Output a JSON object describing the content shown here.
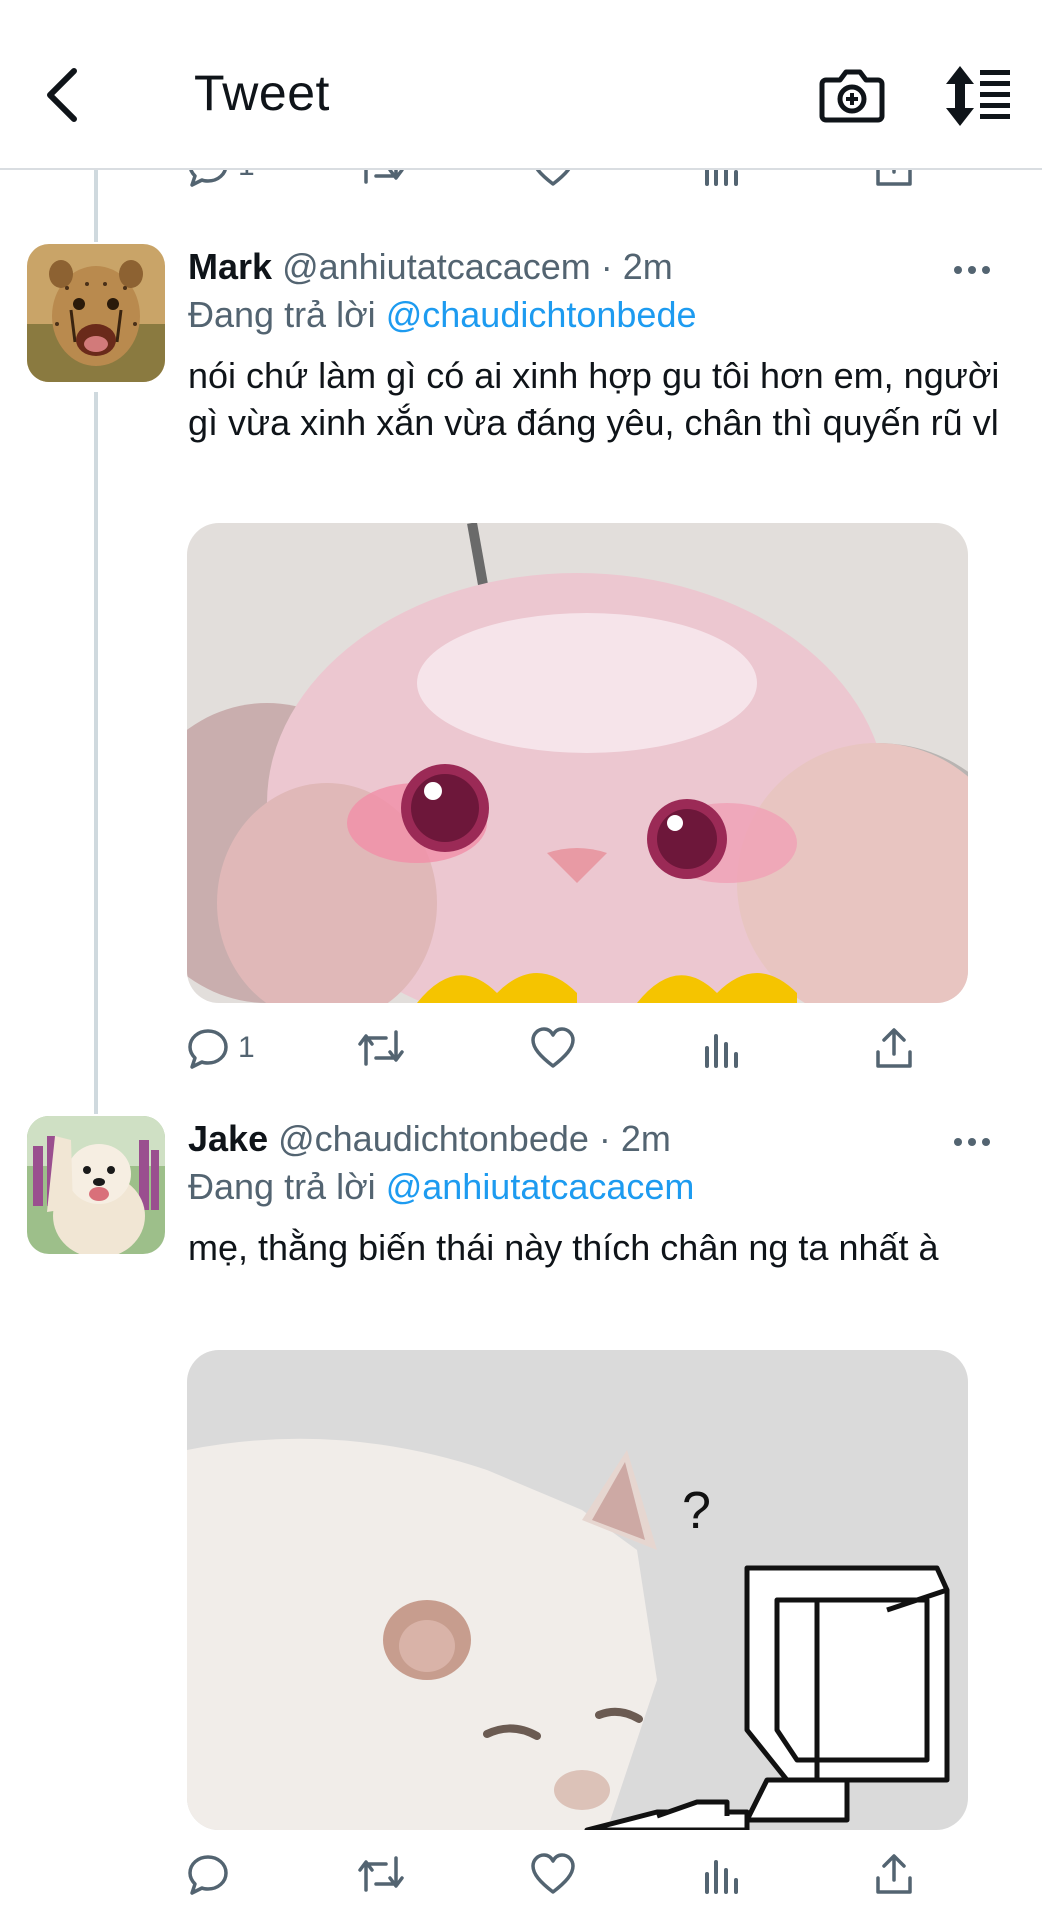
{
  "header": {
    "title": "Tweet"
  },
  "icons": {
    "back": "chevron-left-icon",
    "camera": "camera-plus-icon",
    "sort": "sort-icon",
    "more": "more-dots-icon",
    "reply": "reply-icon",
    "retweet": "retweet-icon",
    "like": "heart-icon",
    "analytics": "analytics-icon",
    "share": "share-icon"
  },
  "top_actions": {
    "reply_count": "1"
  },
  "tweets": [
    {
      "name": "Mark",
      "handle": "@anhiutatcacacem · 2m",
      "replying_prefix": "Đang trả lời",
      "replying_to": "@chaudichtonbede",
      "text": "nói chứ làm gì có ai xinh hợp gu tôi hơn em, người gì vừa xinh xắn vừa đáng yêu, chân thì quyến rũ vl",
      "reply_count": "1"
    },
    {
      "name": "Jake",
      "handle": "@chaudichtonbede · 2m",
      "replying_prefix": "Đang trả lời",
      "replying_to": "@anhiutatcacacem",
      "text": "mẹ, thằng biến thái này thích chân ng ta nhất à",
      "reply_count": ""
    }
  ],
  "media_labels": {
    "computer_question": "?"
  },
  "colors": {
    "link": "#1d9bf0",
    "secondary_text": "#536471",
    "thread_line": "#cfd9de"
  }
}
